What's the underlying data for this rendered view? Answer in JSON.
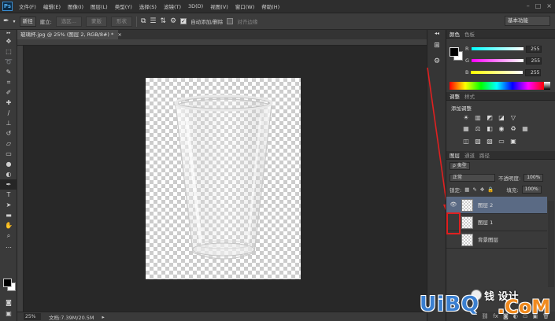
{
  "app": {
    "logo": "Ps"
  },
  "menu": [
    "文件(F)",
    "编辑(E)",
    "图像(I)",
    "图层(L)",
    "类型(Y)",
    "选择(S)",
    "滤镜(T)",
    "3D(D)",
    "视图(V)",
    "窗口(W)",
    "帮助(H)"
  ],
  "window_controls": [
    "–",
    "□",
    "×"
  ],
  "options": {
    "tool_icon": "brush-icon",
    "mode_select": "新径",
    "build_label": "建立:",
    "selection_btn": "选区...",
    "mask_btn": "蒙版",
    "shape_btn": "形状",
    "auto_add_label": "自动添加/删除",
    "auto_add_checked": true,
    "align_edges_label": "对齐边缘",
    "workspace": "基本功能"
  },
  "document": {
    "tab_title": "玻璃杯.jpg @ 25% (图层 2, RGB/8#) *",
    "tab_close": "×",
    "zoom": "25%",
    "doc_size": "文档:7.39M/20.5M"
  },
  "tools": [
    "move",
    "marquee",
    "lasso",
    "quick-select",
    "crop",
    "eyedropper",
    "healing",
    "brush",
    "stamp",
    "history",
    "eraser",
    "gradient",
    "blur",
    "dodge",
    "pen",
    "type",
    "path-select",
    "shape",
    "hand",
    "zoom"
  ],
  "color_panel": {
    "tabs": [
      "颜色",
      "色板"
    ],
    "channels": [
      {
        "label": "R",
        "value": "255",
        "gradient": "linear-gradient(90deg,#00ffff,#ffffff)"
      },
      {
        "label": "G",
        "value": "255",
        "gradient": "linear-gradient(90deg,#ff00ff,#ffffff)"
      },
      {
        "label": "B",
        "value": "255",
        "gradient": "linear-gradient(90deg,#ffff00,#ffffff)"
      }
    ]
  },
  "adjust_panel": {
    "tabs": [
      "调整",
      "样式"
    ],
    "title": "添加调整"
  },
  "layers_panel": {
    "tabs": [
      "图层",
      "通道",
      "路径"
    ],
    "filter_label": "ρ 类型",
    "blend_mode": "正常",
    "opacity_label": "不透明度:",
    "opacity": "100%",
    "lock_label": "锁定:",
    "fill_label": "填充:",
    "fill": "100%",
    "layers": [
      {
        "name": "图层 2",
        "visible": true,
        "selected": true
      },
      {
        "name": "图层 1",
        "visible": false,
        "selected": false
      },
      {
        "name": "背景图层",
        "visible": false,
        "selected": false
      }
    ]
  },
  "watermark": {
    "cn": "钱 设计",
    "brand": "UiBQ",
    "suffix": ".CoM"
  },
  "colors": {
    "highlight": "#e02020",
    "selected_layer": "#5a6a84",
    "brand_blue": "#3a7fd0",
    "brand_orange": "#f08a1e"
  }
}
